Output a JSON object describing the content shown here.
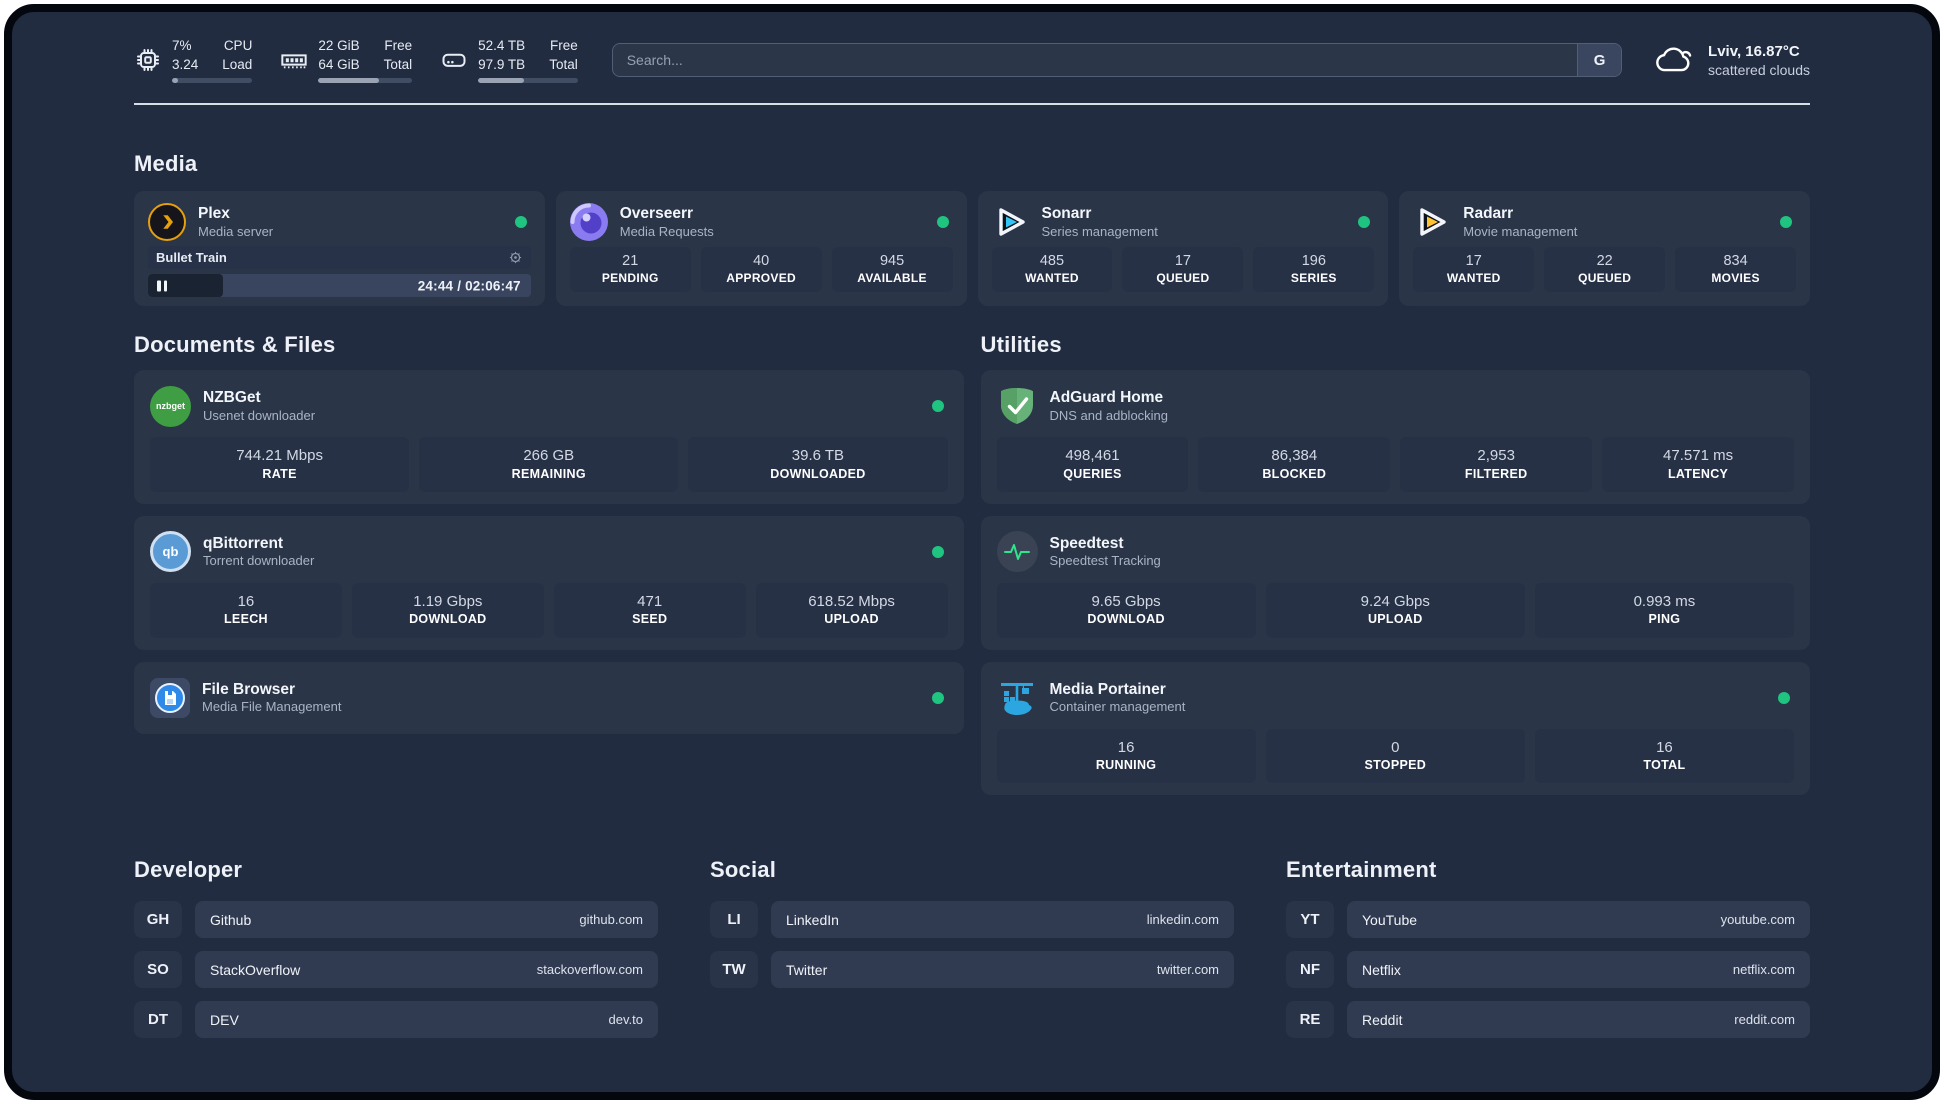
{
  "colors": {
    "status_online": "#1fc480",
    "plex_orange": "#e5a00d",
    "sonarr_blue": "#35c5f4",
    "radarr_yellow": "#ffc230",
    "portainer_blue": "#2ca6e0",
    "adguard_green": "#5fb36b",
    "speedtest_green": "#2ee58b"
  },
  "header": {
    "cpu": {
      "value_top": "7%",
      "value_bottom": "3.24",
      "label_top": "CPU",
      "label_bottom": "Load",
      "progress_pct": 7
    },
    "memory": {
      "value_top": "22 GiB",
      "value_bottom": "64 GiB",
      "label_top": "Free",
      "label_bottom": "Total",
      "progress_pct": 65
    },
    "storage": {
      "value_top": "52.4 TB",
      "value_bottom": "97.9 TB",
      "label_top": "Free",
      "label_bottom": "Total",
      "progress_pct": 46
    },
    "search": {
      "placeholder": "Search...",
      "engine_button": "G"
    },
    "weather": {
      "location": "Lviv, 16.87°C",
      "condition": "scattered clouds"
    }
  },
  "sections": {
    "media": "Media",
    "documents": "Documents & Files",
    "utilities": "Utilities",
    "developer": "Developer",
    "social": "Social",
    "entertainment": "Entertainment"
  },
  "apps": {
    "plex": {
      "name": "Plex",
      "description": "Media server",
      "now_playing": {
        "title": "Bullet Train",
        "time_display": "24:44 / 02:06:47",
        "progress_pct": 19.5
      }
    },
    "overseerr": {
      "name": "Overseerr",
      "description": "Media Requests",
      "stats": [
        {
          "value": "21",
          "label": "PENDING"
        },
        {
          "value": "40",
          "label": "APPROVED"
        },
        {
          "value": "945",
          "label": "AVAILABLE"
        }
      ]
    },
    "sonarr": {
      "name": "Sonarr",
      "description": "Series management",
      "stats": [
        {
          "value": "485",
          "label": "WANTED"
        },
        {
          "value": "17",
          "label": "QUEUED"
        },
        {
          "value": "196",
          "label": "SERIES"
        }
      ]
    },
    "radarr": {
      "name": "Radarr",
      "description": "Movie management",
      "stats": [
        {
          "value": "17",
          "label": "WANTED"
        },
        {
          "value": "22",
          "label": "QUEUED"
        },
        {
          "value": "834",
          "label": "MOVIES"
        }
      ]
    },
    "nzbget": {
      "name": "NZBGet",
      "description": "Usenet downloader",
      "icon_text": "nzbget",
      "stats": [
        {
          "value": "744.21 Mbps",
          "label": "RATE"
        },
        {
          "value": "266 GB",
          "label": "REMAINING"
        },
        {
          "value": "39.6 TB",
          "label": "DOWNLOADED"
        }
      ]
    },
    "qbittorrent": {
      "name": "qBittorrent",
      "description": "Torrent downloader",
      "icon_text": "qb",
      "stats": [
        {
          "value": "16",
          "label": "LEECH"
        },
        {
          "value": "1.19 Gbps",
          "label": "DOWNLOAD"
        },
        {
          "value": "471",
          "label": "SEED"
        },
        {
          "value": "618.52 Mbps",
          "label": "UPLOAD"
        }
      ]
    },
    "filebrowser": {
      "name": "File Browser",
      "description": "Media File Management"
    },
    "adguard": {
      "name": "AdGuard Home",
      "description": "DNS and adblocking",
      "stats": [
        {
          "value": "498,461",
          "label": "QUERIES"
        },
        {
          "value": "86,384",
          "label": "BLOCKED"
        },
        {
          "value": "2,953",
          "label": "FILTERED"
        },
        {
          "value": "47.571 ms",
          "label": "LATENCY"
        }
      ]
    },
    "speedtest": {
      "name": "Speedtest",
      "description": "Speedtest Tracking",
      "stats": [
        {
          "value": "9.65 Gbps",
          "label": "DOWNLOAD"
        },
        {
          "value": "9.24 Gbps",
          "label": "UPLOAD"
        },
        {
          "value": "0.993 ms",
          "label": "PING"
        }
      ]
    },
    "portainer": {
      "name": "Media Portainer",
      "description": "Container management",
      "stats": [
        {
          "value": "16",
          "label": "RUNNING"
        },
        {
          "value": "0",
          "label": "STOPPED"
        },
        {
          "value": "16",
          "label": "TOTAL"
        }
      ]
    }
  },
  "bookmarks": {
    "developer": {
      "title": "Developer",
      "items": [
        {
          "abbr": "GH",
          "name": "Github",
          "url": "github.com"
        },
        {
          "abbr": "SO",
          "name": "StackOverflow",
          "url": "stackoverflow.com"
        },
        {
          "abbr": "DT",
          "name": "DEV",
          "url": "dev.to"
        }
      ]
    },
    "social": {
      "title": "Social",
      "items": [
        {
          "abbr": "LI",
          "name": "LinkedIn",
          "url": "linkedin.com"
        },
        {
          "abbr": "TW",
          "name": "Twitter",
          "url": "twitter.com"
        }
      ]
    },
    "entertainment": {
      "title": "Entertainment",
      "items": [
        {
          "abbr": "YT",
          "name": "YouTube",
          "url": "youtube.com"
        },
        {
          "abbr": "NF",
          "name": "Netflix",
          "url": "netflix.com"
        },
        {
          "abbr": "RE",
          "name": "Reddit",
          "url": "reddit.com"
        }
      ]
    }
  }
}
